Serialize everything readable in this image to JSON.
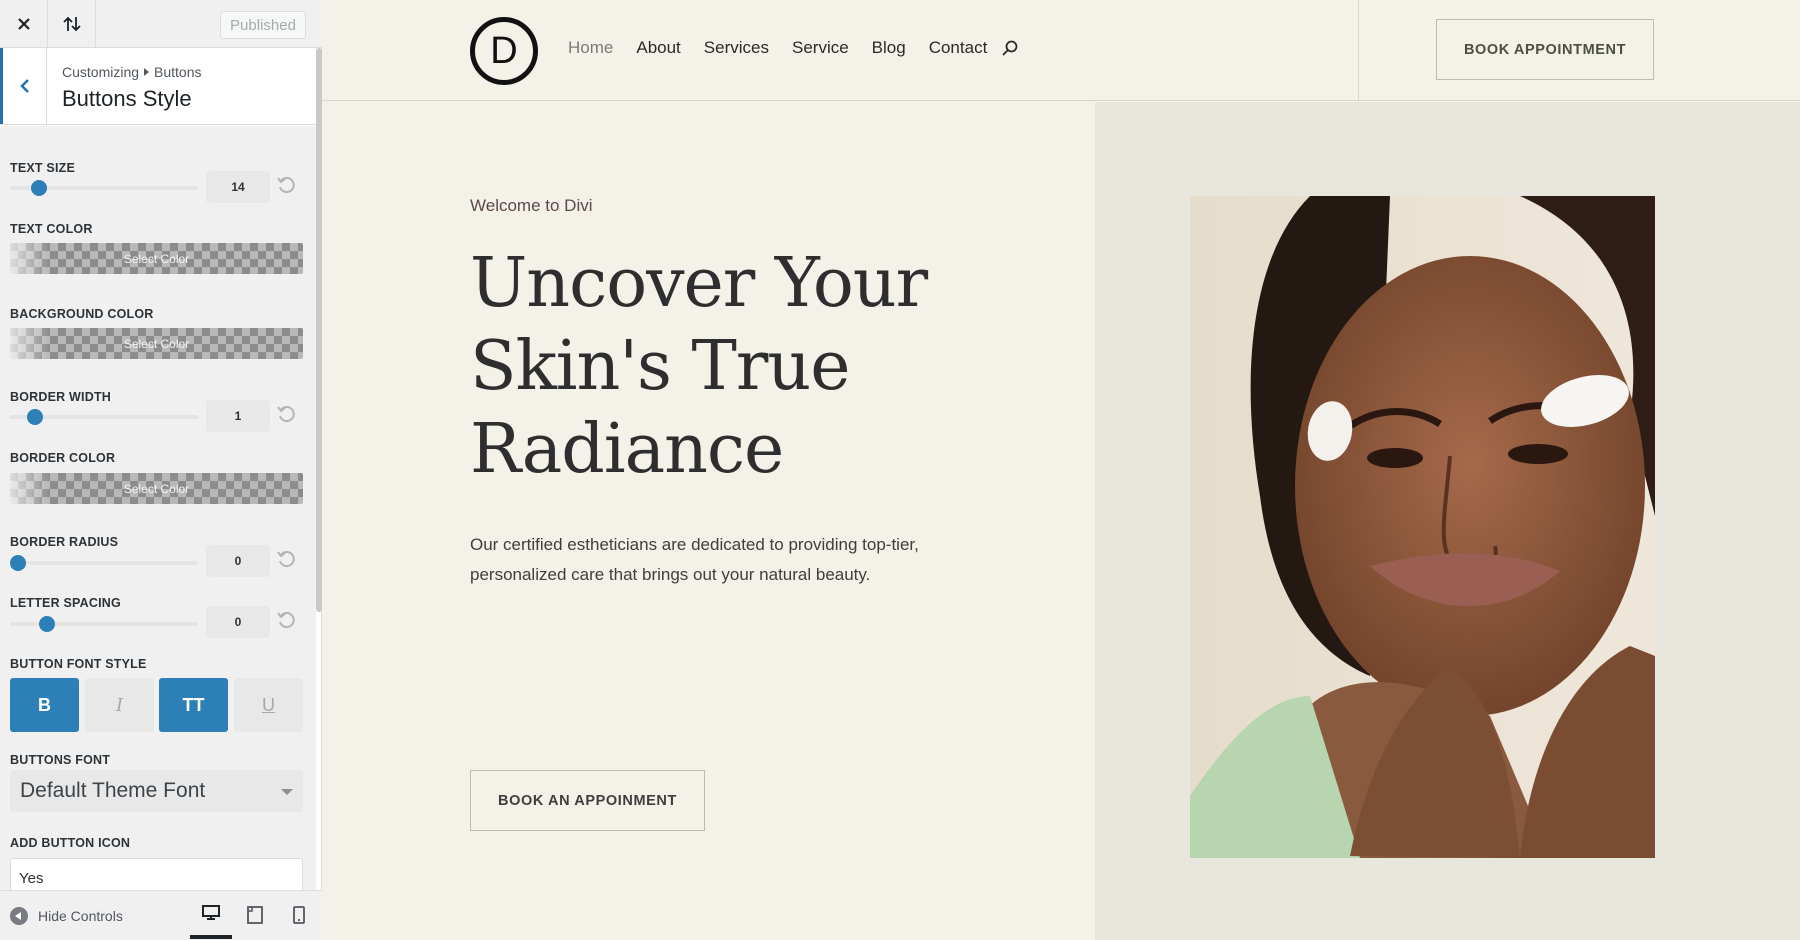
{
  "panel": {
    "publish_label": "Published",
    "breadcrumb": {
      "root": "Customizing",
      "section": "Buttons"
    },
    "section_title": "Buttons Style",
    "controls": {
      "text_size": {
        "label": "TEXT SIZE",
        "value": "14",
        "level": 0.12
      },
      "text_color": {
        "label": "TEXT COLOR",
        "button": "Select Color"
      },
      "background_color": {
        "label": "BACKGROUND COLOR",
        "button": "Select Color"
      },
      "border_width": {
        "label": "BORDER WIDTH",
        "value": "1",
        "level": 0.1
      },
      "border_color": {
        "label": "BORDER COLOR",
        "button": "Select Color"
      },
      "border_radius": {
        "label": "BORDER RADIUS",
        "value": "0",
        "level": 0.0
      },
      "letter_spacing": {
        "label": "LETTER SPACING",
        "value": "0",
        "level": 0.17
      },
      "button_font_style": {
        "label": "BUTTON FONT STYLE",
        "options": [
          {
            "glyph": "B",
            "active": true
          },
          {
            "glyph": "I",
            "active": false
          },
          {
            "glyph": "TT",
            "active": true
          },
          {
            "glyph": "U",
            "active": false
          }
        ]
      },
      "buttons_font": {
        "label": "BUTTONS FONT",
        "value": "Default Theme Font"
      },
      "add_button_icon": {
        "label": "ADD BUTTON ICON",
        "value": "Yes"
      }
    },
    "footer": {
      "hide_controls": "Hide Controls",
      "active_device": "desktop"
    }
  },
  "site": {
    "logo_letter": "D",
    "nav": [
      "Home",
      "About",
      "Services",
      "Service",
      "Blog",
      "Contact"
    ],
    "header_cta": "BOOK APPOINTMENT",
    "hero": {
      "eyebrow": "Welcome to Divi",
      "title_lines": [
        "Uncover Your",
        "Skin's True",
        "Radiance"
      ],
      "text_lines": [
        "Our certified estheticians are dedicated to providing top-tier,",
        "personalized care that brings out your natural beauty."
      ],
      "cta": "BOOK AN APPOINMENT"
    }
  },
  "colors": {
    "accent": "#2d7fb8",
    "page_bg": "#f3f1e8",
    "hero_right_bg": "#e9e6de"
  }
}
